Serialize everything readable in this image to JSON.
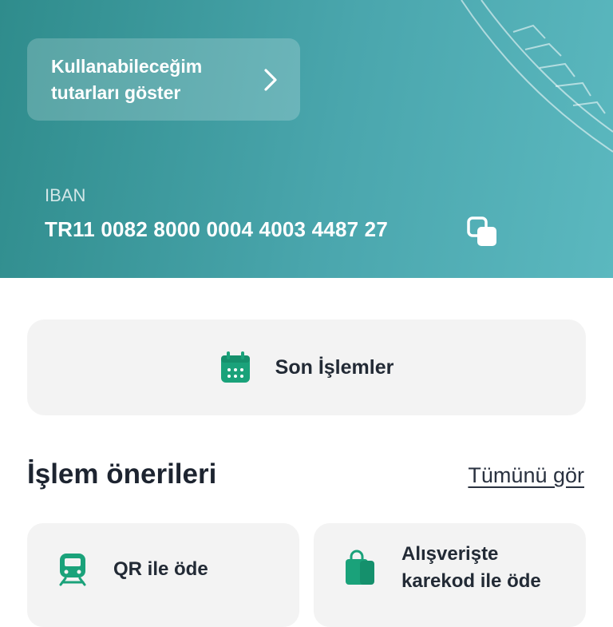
{
  "hero": {
    "show_amounts_label": "Kullanabileceğim tutarları göster",
    "iban_label": "IBAN",
    "iban_value": "TR11 0082 8000 0004 4003 4487 27"
  },
  "recent_transactions": {
    "label": "Son İşlemler"
  },
  "suggestions": {
    "title": "İşlem önerileri",
    "see_all": "Tümünü gör",
    "items": [
      {
        "label": "QR ile öde",
        "icon": "train-icon"
      },
      {
        "label": "Alışverişte karekod ile öde",
        "icon": "shopping-bag-icon"
      }
    ]
  },
  "colors": {
    "brand_teal": "#2f8c8c",
    "accent_green": "#1aa27a",
    "card_bg": "#f3f3f3"
  }
}
